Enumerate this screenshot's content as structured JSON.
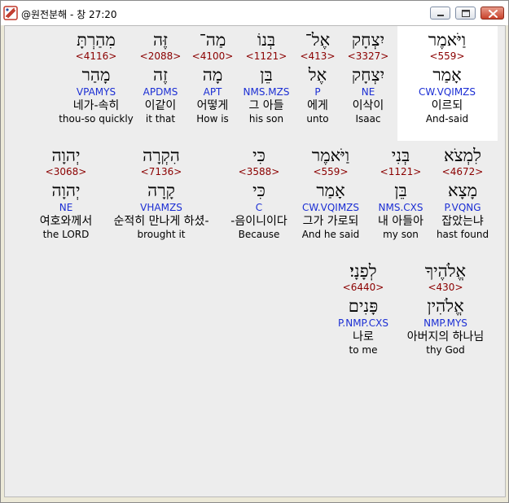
{
  "window": {
    "title": "@원전분해 - 창 27:20"
  },
  "icons": {
    "app": "app-logo-icon",
    "minimize": "minimize-icon",
    "maximize": "maximize-icon",
    "close": "close-icon"
  },
  "rows": [
    {
      "words": [
        {
          "hebrew": "וַיֹּאמֶר",
          "strong": "<559>",
          "lexeme": "אָמַר",
          "morph": "CW.VQIMZS",
          "korean": "이르되",
          "english": "And-said",
          "highlight": true
        },
        {
          "hebrew": "יִצְחָק",
          "strong": "<3327>",
          "lexeme": "יִצְחָק",
          "morph": "NE",
          "korean": "이삭이",
          "english": "Isaac"
        },
        {
          "hebrew": "אֶל־",
          "strong": "<413>",
          "lexeme": "אֶל",
          "morph": "P",
          "korean": "에게",
          "english": "unto"
        },
        {
          "hebrew": "בְּנוֹ",
          "strong": "<1121>",
          "lexeme": "בֵּן",
          "morph": "NMS.MZS",
          "korean": "그 아들",
          "english": "his son"
        },
        {
          "hebrew": "מַה־",
          "strong": "<4100>",
          "lexeme": "מָה",
          "morph": "APT",
          "korean": "어떻게",
          "english": "How is"
        },
        {
          "hebrew": "זֶּה",
          "strong": "<2088>",
          "lexeme": "זֶה",
          "morph": "APDMS",
          "korean": "이같이",
          "english": "it that"
        },
        {
          "hebrew": "מִהַרְתָּ",
          "strong": "<4116>",
          "lexeme": "מָהַר",
          "morph": "VPAMYS",
          "korean": "네가-속히",
          "english": "thou-so quickly"
        }
      ]
    },
    {
      "words": [
        {
          "hebrew": "לִמְצֹא",
          "strong": "<4672>",
          "lexeme": "מָצָא",
          "morph": "P.VQNG",
          "korean": "잡았는냐",
          "english": "hast found"
        },
        {
          "hebrew": "בְּנִי",
          "strong": "<1121>",
          "lexeme": "בֵּן",
          "morph": "NMS.CXS",
          "korean": "내 아들아",
          "english": "my son"
        },
        {
          "hebrew": "וַיֹּאמֶר",
          "strong": "<559>",
          "lexeme": "אָמַר",
          "morph": "CW.VQIMZS",
          "korean": "그가 가로되",
          "english": "And he said"
        },
        {
          "hebrew": "כִּי",
          "strong": "<3588>",
          "lexeme": "כִּי",
          "morph": "C",
          "korean": "-음이니이다",
          "english": "Because"
        },
        {
          "hebrew": "הִקְרָה",
          "strong": "<7136>",
          "lexeme": "קָרָה",
          "morph": "VHAMZS",
          "korean": "순적히 만나게 하셨-",
          "english": "brought it"
        },
        {
          "hebrew": "יְהוָה",
          "strong": "<3068>",
          "lexeme": "יְהוָה",
          "morph": "NE",
          "korean": "여호와께서",
          "english": "the LORD"
        }
      ]
    },
    {
      "words": [
        {
          "hebrew": "אֱלֹהֶיךָ",
          "strong": "<430>",
          "lexeme": "אֱלֹהִין",
          "morph": "NMP.MYS",
          "korean": "아버지의 하나님",
          "english": "thy God"
        },
        {
          "hebrew": "לְפָנָי׃",
          "strong": "<6440>",
          "lexeme": "פָּנִים",
          "morph": "P.NMP.CXS",
          "korean": "나로",
          "english": "to me"
        }
      ]
    }
  ]
}
